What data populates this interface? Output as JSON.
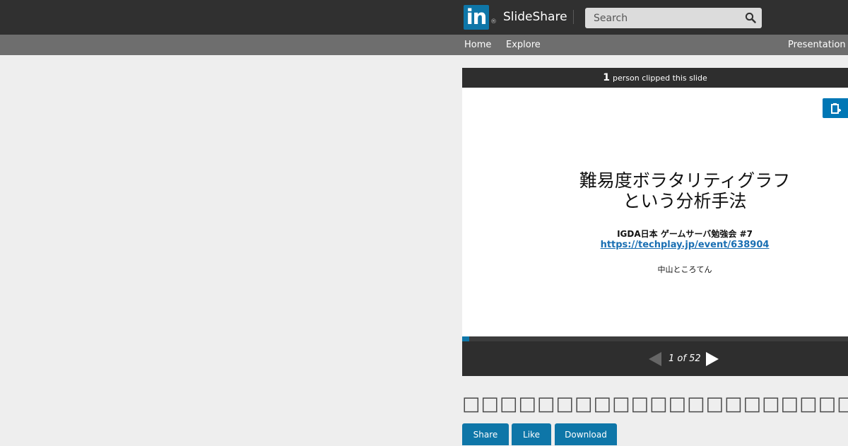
{
  "header": {
    "logo_text": "in",
    "registered_mark": "®",
    "brand_name": "SlideShare",
    "search": {
      "placeholder": "Search",
      "value": ""
    }
  },
  "nav": {
    "items": [
      {
        "label": "Home"
      },
      {
        "label": "Explore"
      },
      {
        "label": "Presentation"
      }
    ]
  },
  "player": {
    "clip_count": "1",
    "clip_text": "person clipped this slide",
    "slide": {
      "title_line1": "難易度ボラタリティグラフ",
      "title_line2": "という分析手法",
      "subtitle": "IGDA日本 ゲームサーバ勉強会 #7",
      "link": "https://techplay.jp/event/638904",
      "author": "中山ところてん"
    },
    "current_page": 1,
    "total_pages": 52,
    "page_indicator": "1 of 52",
    "progress_fraction": 0.019
  },
  "document": {
    "title": "□□□□□□□□□□□□□□□□□□□□□□",
    "actions": [
      {
        "label": "Share"
      },
      {
        "label": "Like"
      },
      {
        "label": "Download"
      }
    ]
  },
  "colors": {
    "header_bg": "#303030",
    "nav_bg": "#6e6e6e",
    "accent": "#0e76a8",
    "player_bg": "#2e2e2e",
    "page_bg": "#eeeeee"
  },
  "icons": {
    "search": "search-icon",
    "clip": "clipboard-icon",
    "prev": "triangle-left-icon",
    "next": "triangle-right-icon"
  }
}
